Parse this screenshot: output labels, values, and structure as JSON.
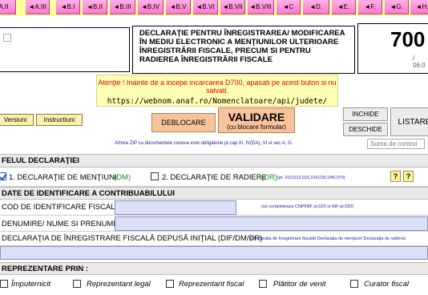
{
  "nav": {
    "items": [
      "A.II",
      "◄A.III",
      "◄B.I",
      "◄B.II",
      "◄B.III",
      "◄B.IV",
      "◄B.V",
      "◄B.VI",
      "◄B.VII",
      "◄B.VIII",
      "◄C",
      "◄D.",
      "◄E.",
      "◄F.",
      "◄G.",
      "◄H."
    ]
  },
  "header": {
    "title": "DECLARAŢIE PENTRU ÎNREGISTRAREA/ MODIFICAREA ÎN MEDIU ELECTRONIC A MENŢIUNILOR ULTERIOARE ÎNREGISTRĂRII FISCALE, PRECUM SI PENTRU RADIEREA ÎNREGISTRĂRII FISCALE",
    "form_number": "700",
    "form_sub": "/ 06.0"
  },
  "notice": {
    "line1": "Atenţie ! Inainte de a incepe incarcarea D700, apasati pe acest buton si nu salvati.",
    "line2": "https://webnom.anaf.ro/Nomenclatoare/api/judete/"
  },
  "buttons": {
    "versiuni": "Versiuni",
    "instructiuni": "Instructiuni",
    "deblocare": "DEBLOCARE",
    "validare": "VALIDARE",
    "validare_sub": "(cu blocare formular)",
    "inchide": "INCHIDE",
    "deschide": "DESCHIDE",
    "listare": "LISTARE"
  },
  "arhiva_text": "Arhiva ZIP cu documentele conexe este obligatorie pt.cap III, IV(DA), VI si sec A, G.",
  "suma_control_placeholder": "Suma de control",
  "felul": {
    "section_title": "FELUL DECLARAŢIEI",
    "opt1_label": "1. DECLARAŢIE DE MENŢIUNI",
    "opt1_code": "(DM)",
    "opt2_label": "2. DECLARAŢIE DE RADIERE",
    "opt2_code": "(DR)",
    "opt2_note": "(pt. 010,013,015,016,030,040,070)",
    "help": "?"
  },
  "identificare": {
    "section_title": "DATE DE IDENTIFICARE  A CONTRIBUABILULUI",
    "cod_label": "COD DE IDENTIFICARE FISCALĂ",
    "cod_note": "(se completeaza CNP/NIF pt.020 si NIF pt.030)",
    "denumire_label": "DENUMIRE/ NUME SI PRENUME",
    "declaratia_label": "DECLARAŢIA DE ÎNREGISTRARE FISCALĂ DEPUSĂ INIŢIAL (DIF/DM/DR)",
    "declaratia_note": "(Declaratia de înregistrare fiscală/ Declaraţia de menţiuni/ Declaraţia de radiere)"
  },
  "reprezentare": {
    "section_title": "REPREZENTARE PRIN :",
    "options": [
      "Împuternicit",
      "Reprezentant legal",
      "Reprezentant fiscal",
      "Plătitor de venit",
      "Curator fiscal"
    ]
  },
  "colors": {
    "nav_pink": "#ff8fd8",
    "notice_red": "#e00000",
    "field_blue": "#dce0f7",
    "dm_green": "#1a8a1a"
  }
}
